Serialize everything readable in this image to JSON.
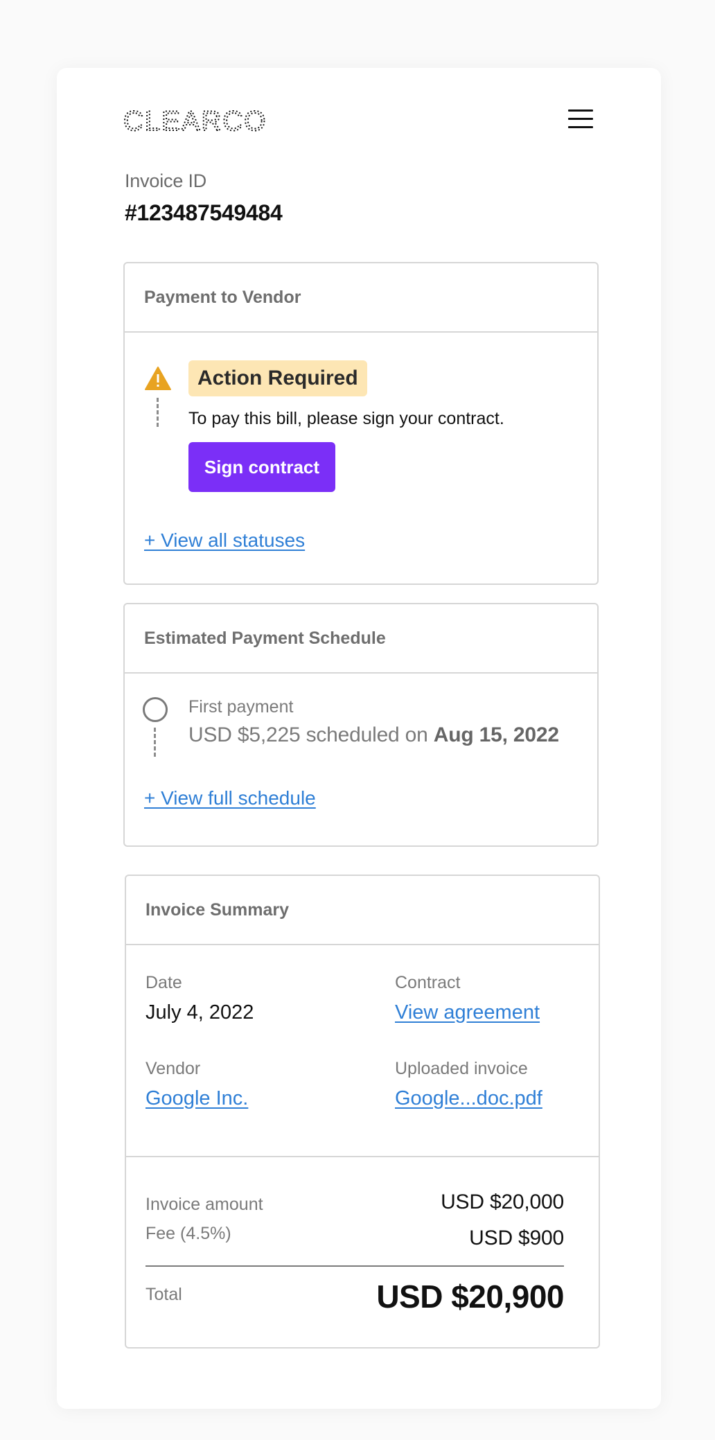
{
  "header": {
    "logo_text": "CLEARCO",
    "menu_icon": "hamburger-menu-icon"
  },
  "invoice": {
    "id_label": "Invoice ID",
    "id_value": "#123487549484"
  },
  "payment_card": {
    "title": "Payment to Vendor",
    "status_badge": "Action Required",
    "status_icon": "warning-icon",
    "status_color": "#fde6b4",
    "description": "To pay this bill, please sign your contract.",
    "button_label": "Sign contract",
    "button_color": "#7b2ff7",
    "link_label": "+ View all statuses"
  },
  "schedule_card": {
    "title": "Estimated Payment Schedule",
    "item_label": "First payment",
    "item_amount_text": "USD $5,225 scheduled on",
    "item_date": "Aug 15, 2022",
    "link_label": "+ View full schedule"
  },
  "summary_card": {
    "title": "Invoice Summary",
    "fields": [
      {
        "label": "Date",
        "value": "July 4, 2022"
      },
      {
        "label": "Contract",
        "value": "View agreement"
      },
      {
        "label": "Vendor",
        "value": "Google Inc."
      },
      {
        "label": "Uploaded invoice",
        "value": "Google...doc.pdf"
      }
    ],
    "invoice_amount_label": "Invoice amount",
    "invoice_amount_value": "USD $20,000",
    "fee_label": "Fee (4.5%)",
    "fee_value": "USD $900",
    "total_label": "Total",
    "total_value": "USD $20,900"
  },
  "colors": {
    "link": "#2f7fd6",
    "warning": "#e8a321"
  }
}
